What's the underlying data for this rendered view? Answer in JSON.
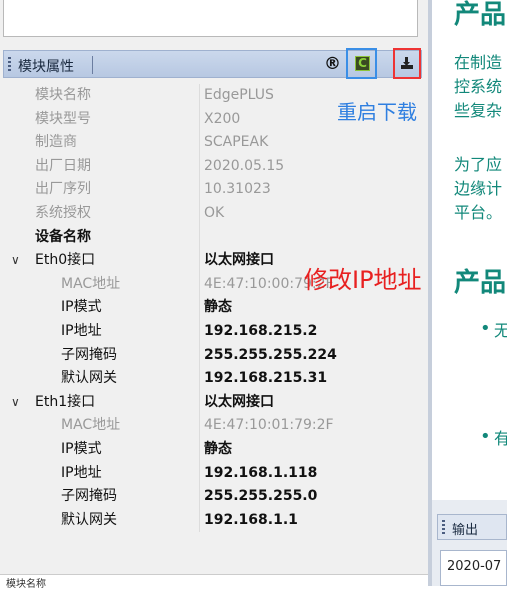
{
  "panel": {
    "title": "模块属性"
  },
  "annotations": {
    "restart_download": "重启下载",
    "modify_ip": "修改IP地址"
  },
  "toolbar": {
    "reg_symbol": "®",
    "restart_symbol": "C"
  },
  "properties": [
    {
      "k": "模块名称",
      "v": "EdgePLUS"
    },
    {
      "k": "模块型号",
      "v": "X200"
    },
    {
      "k": "制造商",
      "v": "SCAPEAK"
    },
    {
      "k": "出厂日期",
      "v": "2020.05.15"
    },
    {
      "k": "出厂序列",
      "v": "10.31023"
    },
    {
      "k": "系统授权",
      "v": "OK"
    },
    {
      "k": "设备名称",
      "v": ""
    }
  ],
  "eth0": {
    "label": "Eth0接口",
    "type": "以太网接口",
    "mac_label": "MAC地址",
    "mac": "4E:47:10:00:79:2F",
    "ipmode_label": "IP模式",
    "ipmode": "静态",
    "ip_label": "IP地址",
    "ip": "192.168.215.2",
    "mask_label": "子网掩码",
    "mask": "255.255.255.224",
    "gw_label": "默认网关",
    "gw": "192.168.215.31"
  },
  "eth1": {
    "label": "Eth1接口",
    "type": "以太网接口",
    "mac_label": "MAC地址",
    "mac": "4E:47:10:01:79:2F",
    "ipmode_label": "IP模式",
    "ipmode": "静态",
    "ip_label": "IP地址",
    "ip": "192.168.1.118",
    "mask_label": "子网掩码",
    "mask": "255.255.255.0",
    "gw_label": "默认网关",
    "gw": "192.168.1.1"
  },
  "bottom": {
    "label": "模块名称"
  },
  "right": {
    "h1": "产品",
    "p1": "在制造",
    "p2": "控系统",
    "p3": "些复杂",
    "p4": "为了应",
    "p5": "边缘计",
    "p6": "平台。",
    "h2": "产品",
    "b1": "无",
    "b2": "有"
  },
  "output": {
    "tab": "输出",
    "line": "2020-07"
  }
}
